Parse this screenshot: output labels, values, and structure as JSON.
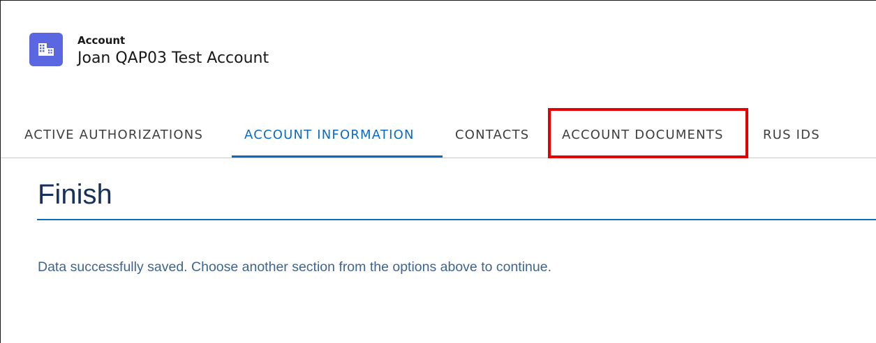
{
  "header": {
    "object_type": "Account",
    "record_name": "Joan QAP03 Test Account",
    "icon": "building-icon",
    "icon_color": "#5a67e0"
  },
  "tabs": [
    {
      "label": "ACTIVE AUTHORIZATIONS",
      "active": false
    },
    {
      "label": "ACCOUNT INFORMATION",
      "active": true
    },
    {
      "label": "CONTACTS",
      "active": false
    },
    {
      "label": "ACCOUNT DOCUMENTS",
      "active": false,
      "highlighted": true
    },
    {
      "label": "RUS IDS",
      "active": false
    }
  ],
  "colors": {
    "active_tab": "#0b6bbf",
    "highlight_box": "#e60000",
    "title": "#16325c",
    "message": "#3e6591"
  },
  "section": {
    "title": "Finish",
    "message": "Data successfully saved. Choose another section from the options above to continue."
  }
}
